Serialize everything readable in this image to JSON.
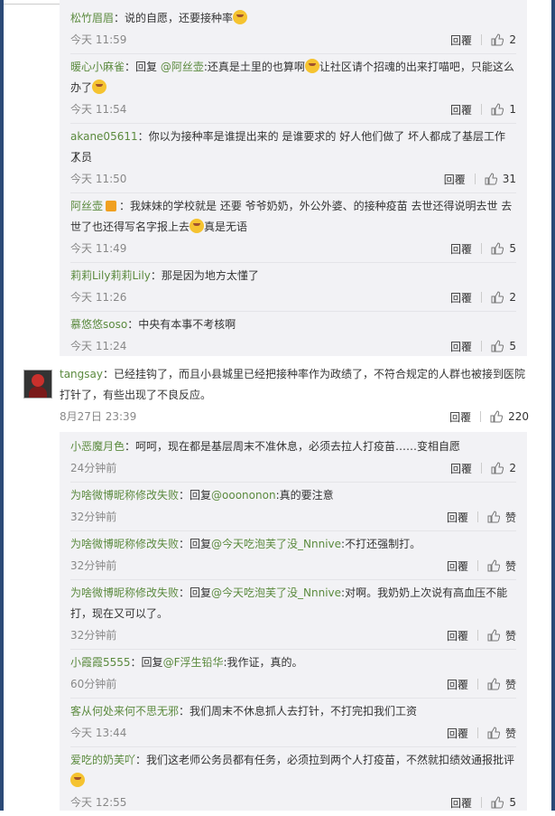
{
  "replies_group_1": [
    {
      "user": "松竹眉眉",
      "segments": [
        {
          "t": "：说的自愿，还要接种率"
        }
      ],
      "emoji_after": true,
      "time": "今天 11:59",
      "reply_label": "回覆",
      "likes": "2"
    },
    {
      "user": "暖心小麻雀",
      "line1": [
        {
          "t": "：回复 "
        },
        {
          "m": "@阿丝壶"
        },
        {
          "t": ":还真是土里的也算啊"
        },
        {
          "e": true
        },
        {
          "t": "让社区请个招魂的出来打喵吧，只能这么"
        }
      ],
      "line2": [
        {
          "t": "办了"
        },
        {
          "e": true
        }
      ],
      "time": "今天 11:54",
      "reply_label": "回覆",
      "likes": "1"
    },
    {
      "user": "akane05611",
      "line1": [
        {
          "t": "：你以为接种率是谁提出来的 是谁要求的 好人他们做了 坏人都成了基层工作人员"
        }
      ],
      "line2": [
        {
          "t": "了"
        }
      ],
      "time": "今天 11:50",
      "reply_label": "回覆",
      "likes": "31"
    },
    {
      "user": "阿丝壶",
      "line1": [
        {
          "tag": true
        },
        {
          "t": "：我妹妹的学校就是 还要 爷爷奶奶，外公外婆、的接种疫苗 去世还得说明去世 去"
        }
      ],
      "line2": [
        {
          "t": "世了也还得写名字报上去"
        },
        {
          "e": true
        },
        {
          "t": "真是无语"
        }
      ],
      "time": "今天 11:49",
      "reply_label": "回覆",
      "likes": "5"
    },
    {
      "user": "莉莉Lily莉莉Lily",
      "segments": [
        {
          "t": "：那是因为地方太懂了"
        }
      ],
      "time": "今天 11:26",
      "reply_label": "回覆",
      "likes": "2"
    },
    {
      "user": "慕悠悠soso",
      "segments": [
        {
          "t": "：中央有本事不考核啊"
        }
      ],
      "time": "今天 11:24",
      "reply_label": "回覆",
      "likes": "5"
    }
  ],
  "main_comment": {
    "user": "tangsay",
    "line1": "：已经挂钩了，而且小县城里已经把接种率作为政绩了，不符合规定的人群也被接到医院",
    "line2": "打针了，有些出现了不良反应。",
    "time": "8月27日 23:39",
    "reply_label": "回覆",
    "likes": "220"
  },
  "replies_group_2": [
    {
      "user": "小恶魔月色",
      "segments": [
        {
          "t": "：呵呵，现在都是基层周末不准休息，必须去拉人打疫苗……变相自愿"
        }
      ],
      "time": "24分钟前",
      "reply_label": "回覆",
      "likes": "2"
    },
    {
      "user": "为啥微博昵称修改失败",
      "segments": [
        {
          "t": "：回复"
        },
        {
          "m": "@ooononon"
        },
        {
          "t": ":真的要注意"
        }
      ],
      "time": "32分钟前",
      "reply_label": "回覆",
      "likes": "赞"
    },
    {
      "user": "为啥微博昵称修改失败",
      "segments": [
        {
          "t": "：回复"
        },
        {
          "m": "@今天吃泡芙了没_Nnnive"
        },
        {
          "t": ":不打还强制打。"
        }
      ],
      "time": "32分钟前",
      "reply_label": "回覆",
      "likes": "赞"
    },
    {
      "user": "为啥微博昵称修改失败",
      "line1": [
        {
          "t": "：回复"
        },
        {
          "m": "@今天吃泡芙了没_Nnnive"
        },
        {
          "t": ":对啊。我奶奶上次说有高血压不能"
        }
      ],
      "line2": [
        {
          "t": "打，现在又可以了。"
        }
      ],
      "time": "32分钟前",
      "reply_label": "回覆",
      "likes": "赞"
    },
    {
      "user": "小霞霞5555",
      "segments": [
        {
          "t": "：回复"
        },
        {
          "m": "@F浮生铅华"
        },
        {
          "t": ":我作证，真的。"
        }
      ],
      "time": "60分钟前",
      "reply_label": "回覆",
      "likes": "赞"
    },
    {
      "user": "客从何处来何不思无邪",
      "segments": [
        {
          "t": "：我们周末不休息抓人去打针，不打完扣我们工资"
        }
      ],
      "time": "今天 13:44",
      "reply_label": "回覆",
      "likes": "赞"
    },
    {
      "user": "爱吃的奶芙吖",
      "line1": [
        {
          "t": "：我们这老师公务员都有任务，必须拉到两个人打疫苗，不然就扣绩效通报批评"
        }
      ],
      "line2": [
        {
          "e": true
        }
      ],
      "time": "今天 12:55",
      "reply_label": "回覆",
      "likes": "5"
    }
  ],
  "colors": {
    "name": "#5b8a3e",
    "side": "#2b4a77",
    "nested_bg": "#f2f2f5"
  },
  "icons": {
    "like": "thumb-up-icon",
    "emoji": "laughing-emoji-icon"
  }
}
